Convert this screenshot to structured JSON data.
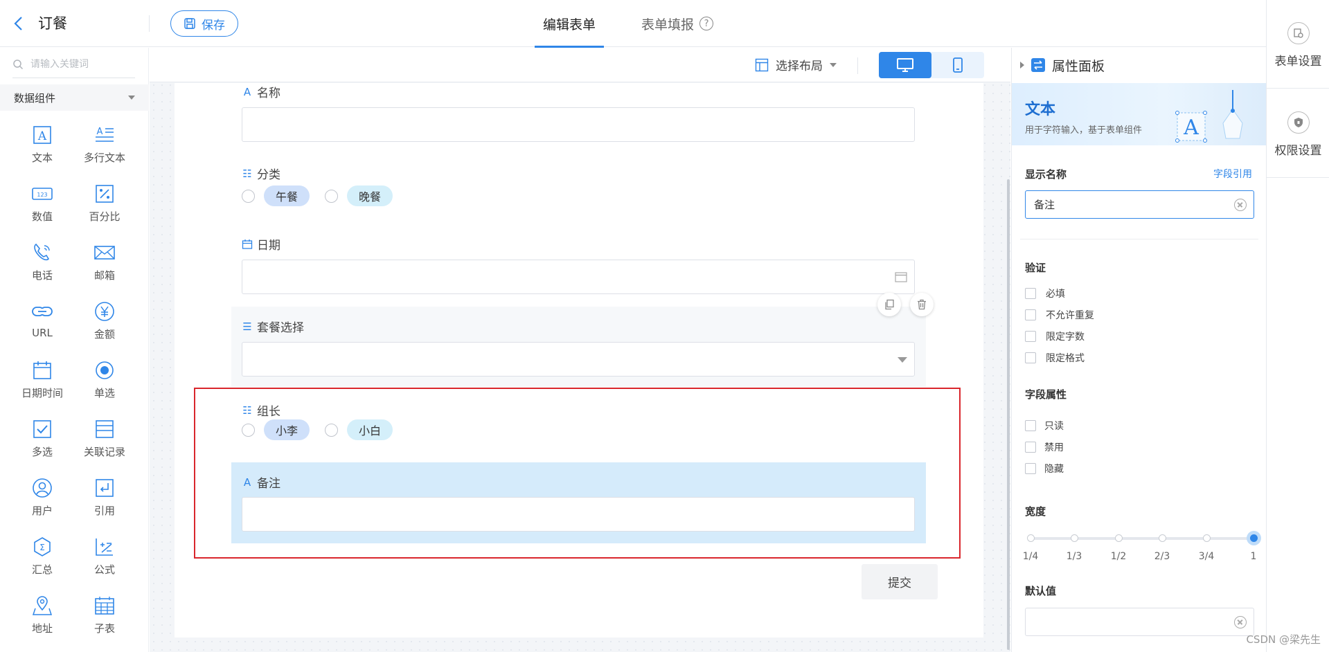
{
  "header": {
    "app_title": "订餐",
    "save_label": "保存",
    "tabs": [
      {
        "label": "编辑表单",
        "active": true
      },
      {
        "label": "表单填报",
        "active": false
      }
    ]
  },
  "settings_bar": {
    "items": [
      {
        "label": "表单设置",
        "icon": "form-settings-icon"
      },
      {
        "label": "权限设置",
        "icon": "shield-icon"
      }
    ]
  },
  "left_panel": {
    "search_placeholder": "请输入关键词",
    "group_title": "数据组件",
    "components": [
      {
        "label": "文本",
        "icon": "text-icon"
      },
      {
        "label": "多行文本",
        "icon": "multiline-text-icon"
      },
      {
        "label": "数值",
        "icon": "number-icon"
      },
      {
        "label": "百分比",
        "icon": "percent-icon"
      },
      {
        "label": "电话",
        "icon": "phone-icon"
      },
      {
        "label": "邮箱",
        "icon": "mail-icon"
      },
      {
        "label": "URL",
        "icon": "link-icon"
      },
      {
        "label": "金额",
        "icon": "yen-icon"
      },
      {
        "label": "日期时间",
        "icon": "calendar-icon"
      },
      {
        "label": "单选",
        "icon": "radio-icon"
      },
      {
        "label": "多选",
        "icon": "checkbox-icon"
      },
      {
        "label": "关联记录",
        "icon": "related-record-icon"
      },
      {
        "label": "用户",
        "icon": "user-icon"
      },
      {
        "label": "引用",
        "icon": "reference-icon"
      },
      {
        "label": "汇总",
        "icon": "sum-icon"
      },
      {
        "label": "公式",
        "icon": "formula-icon"
      },
      {
        "label": "地址",
        "icon": "location-icon"
      },
      {
        "label": "子表",
        "icon": "subtable-icon"
      }
    ]
  },
  "toolbar": {
    "layout_label": "选择布局",
    "devices": [
      {
        "name": "desktop",
        "active": true
      },
      {
        "name": "mobile",
        "active": false
      }
    ]
  },
  "form": {
    "fields": [
      {
        "label": "名称",
        "type": "text"
      },
      {
        "label": "分类",
        "type": "radio",
        "options": [
          "午餐",
          "晚餐"
        ]
      },
      {
        "label": "日期",
        "type": "date"
      },
      {
        "label": "套餐选择",
        "type": "select"
      },
      {
        "label": "组长",
        "type": "radio",
        "options": [
          "小李",
          "小白"
        ]
      },
      {
        "label": "备注",
        "type": "text",
        "selected": true
      }
    ],
    "submit_label": "提交"
  },
  "properties": {
    "panel_title": "属性面板",
    "banner_title": "文本",
    "banner_desc": "用于字符输入，基于表单组件",
    "display_name_label": "显示名称",
    "field_ref_link": "字段引用",
    "display_name_value": "备注",
    "validation_title": "验证",
    "validation_options": [
      "必填",
      "不允许重复",
      "限定字数",
      "限定格式"
    ],
    "field_attr_title": "字段属性",
    "field_attr_options": [
      "只读",
      "禁用",
      "隐藏"
    ],
    "width_title": "宽度",
    "width_ticks": [
      "1/4",
      "1/3",
      "1/2",
      "2/3",
      "3/4",
      "1"
    ],
    "width_value": "1",
    "default_title": "默认值",
    "default_value": ""
  },
  "watermark": "CSDN @梁先生"
}
